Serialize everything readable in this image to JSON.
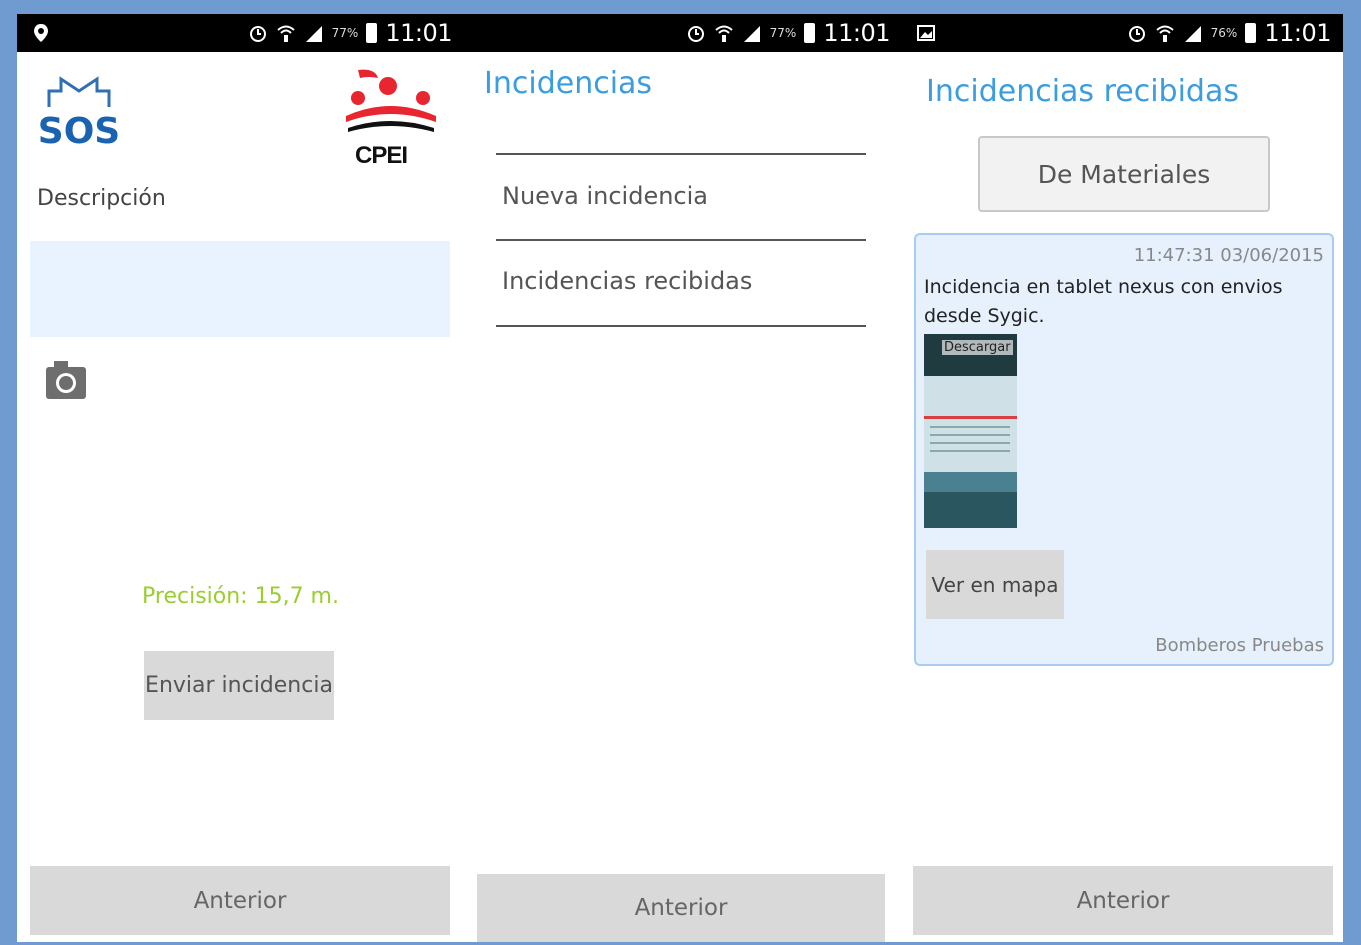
{
  "screens": [
    {
      "status": {
        "battery": "77%",
        "time": "11:01"
      },
      "logos": {
        "left": "SOS",
        "right": "CPEI"
      },
      "description_label": "Descripción",
      "description_value": "",
      "precision": "Precisión: 15,7 m.",
      "send_button": "Enviar incidencia",
      "back_button": "Anterior"
    },
    {
      "status": {
        "battery": "77%",
        "time": "11:01"
      },
      "title": "Incidencias",
      "menu": [
        "Nueva incidencia",
        "Incidencias recibidas"
      ],
      "back_button": "Anterior"
    },
    {
      "status": {
        "battery": "76%",
        "time": "11:01"
      },
      "title": "Incidencias recibidas",
      "filter_button": "De Materiales",
      "incident": {
        "timestamp": "11:47:31 03/06/2015",
        "text": "Incidencia en tablet nexus con envios desde Sygic.",
        "image_label": "Descargar",
        "map_button": "Ver en mapa",
        "author": "Bomberos Pruebas"
      },
      "back_button": "Anterior"
    }
  ],
  "colors": {
    "accent": "#3b9de0",
    "precision": "#9acd32",
    "frame": "#6f9bd1",
    "card_bg": "#e7f1fd",
    "card_border": "#a8cdef",
    "button_grey": "#d9d9d9",
    "input_bg": "#e9f3ff"
  },
  "icons": {
    "status_left_screen1": "location-pin-icon",
    "status_left_screen3": "image-notification-icon",
    "status_right": [
      "alarm-icon",
      "wifi-icon",
      "signal-icon",
      "battery-icon"
    ],
    "camera": "camera-icon"
  }
}
